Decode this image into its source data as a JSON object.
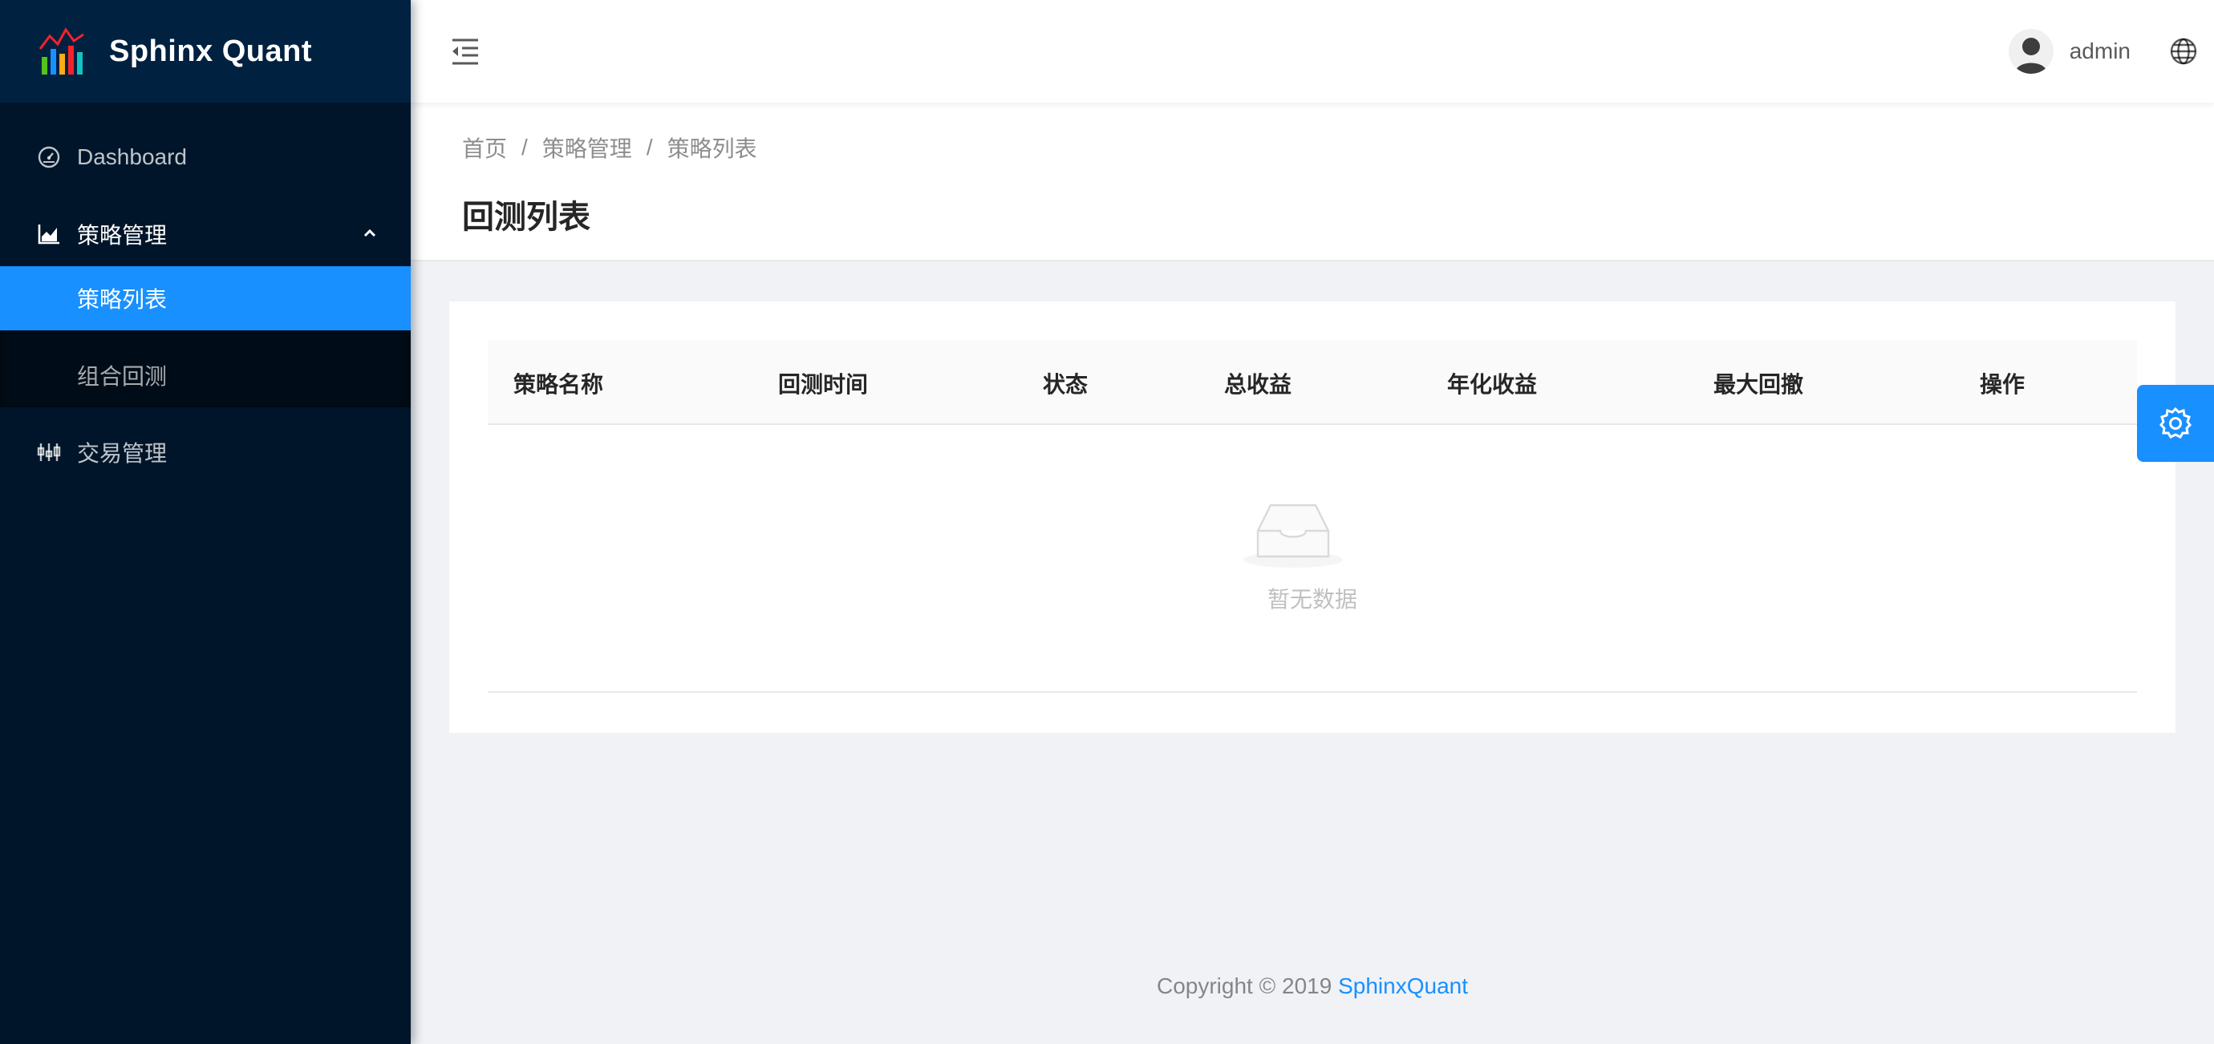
{
  "app": {
    "name": "Sphinx Quant",
    "logo_icon": "bar-chart-logo-icon"
  },
  "sidebar": {
    "items": [
      {
        "label": "Dashboard",
        "icon": "dashboard-icon"
      },
      {
        "label": "策略管理",
        "icon": "area-chart-icon",
        "expanded": true,
        "children": [
          {
            "label": "策略列表",
            "active": true
          },
          {
            "label": "组合回测"
          }
        ]
      },
      {
        "label": "交易管理",
        "icon": "sliders-icon"
      }
    ]
  },
  "header": {
    "trigger_icon": "menu-fold-icon",
    "username": "admin",
    "avatar_icon": "user-avatar-icon",
    "language_icon": "globe-icon"
  },
  "breadcrumb": [
    "首页",
    "策略管理",
    "策略列表"
  ],
  "page": {
    "title": "回测列表"
  },
  "table": {
    "columns": [
      "策略名称",
      "回测时间",
      "状态",
      "总收益",
      "年化收益",
      "最大回撤",
      "操作"
    ],
    "rows": [],
    "empty_text": "暂无数据",
    "empty_icon": "inbox-empty-icon"
  },
  "settings_button": {
    "icon": "setting-icon"
  },
  "footer": {
    "prefix": "Copyright",
    "copyright_symbol": "©",
    "year": "2019",
    "brand": "SphinxQuant"
  },
  "colors": {
    "sidebar_bg": "#001529",
    "logo_bg": "#002140",
    "primary": "#1890ff",
    "page_bg": "#f0f2f5"
  }
}
